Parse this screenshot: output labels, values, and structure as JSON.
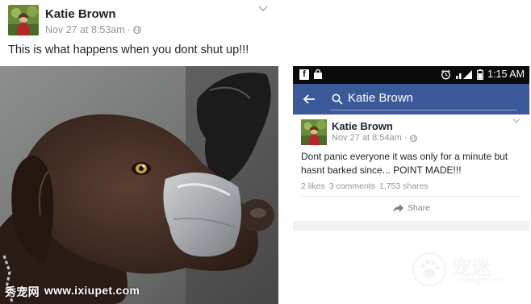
{
  "left_post": {
    "author": "Katie Brown",
    "timestamp": "Nov 27 at 8:53am",
    "separator": "·",
    "privacy_icon": "globe-icon",
    "text": "This is what happens when you dont shut up!!!",
    "menu_icon": "chevron-down-icon"
  },
  "phone": {
    "status_bar": {
      "time": "1:15 AM",
      "icons": [
        "facebook-icon",
        "shopping-bag-icon",
        "alarm-icon",
        "signal-icon",
        "battery-icon"
      ]
    },
    "app_bar": {
      "back_icon": "back-arrow-icon",
      "search_icon": "search-icon",
      "search_query": "Katie Brown",
      "color": "#3b5998"
    },
    "post": {
      "author": "Katie Brown",
      "timestamp": "Nov 27 at 8:54am",
      "separator": "·",
      "privacy_icon": "globe-icon",
      "text": "Dont panic everyone it was only for a minute but hasnt barked since... POINT MADE!!!",
      "likes": "2 likes",
      "comments": "3 comments",
      "shares": "1,753 shares",
      "share_label": "Share"
    }
  },
  "watermarks": {
    "left_text": "秀宠网",
    "left_url": "www.ixiupet.com",
    "right_brand": "宠迷",
    "right_domain": "chongmi.cn"
  }
}
